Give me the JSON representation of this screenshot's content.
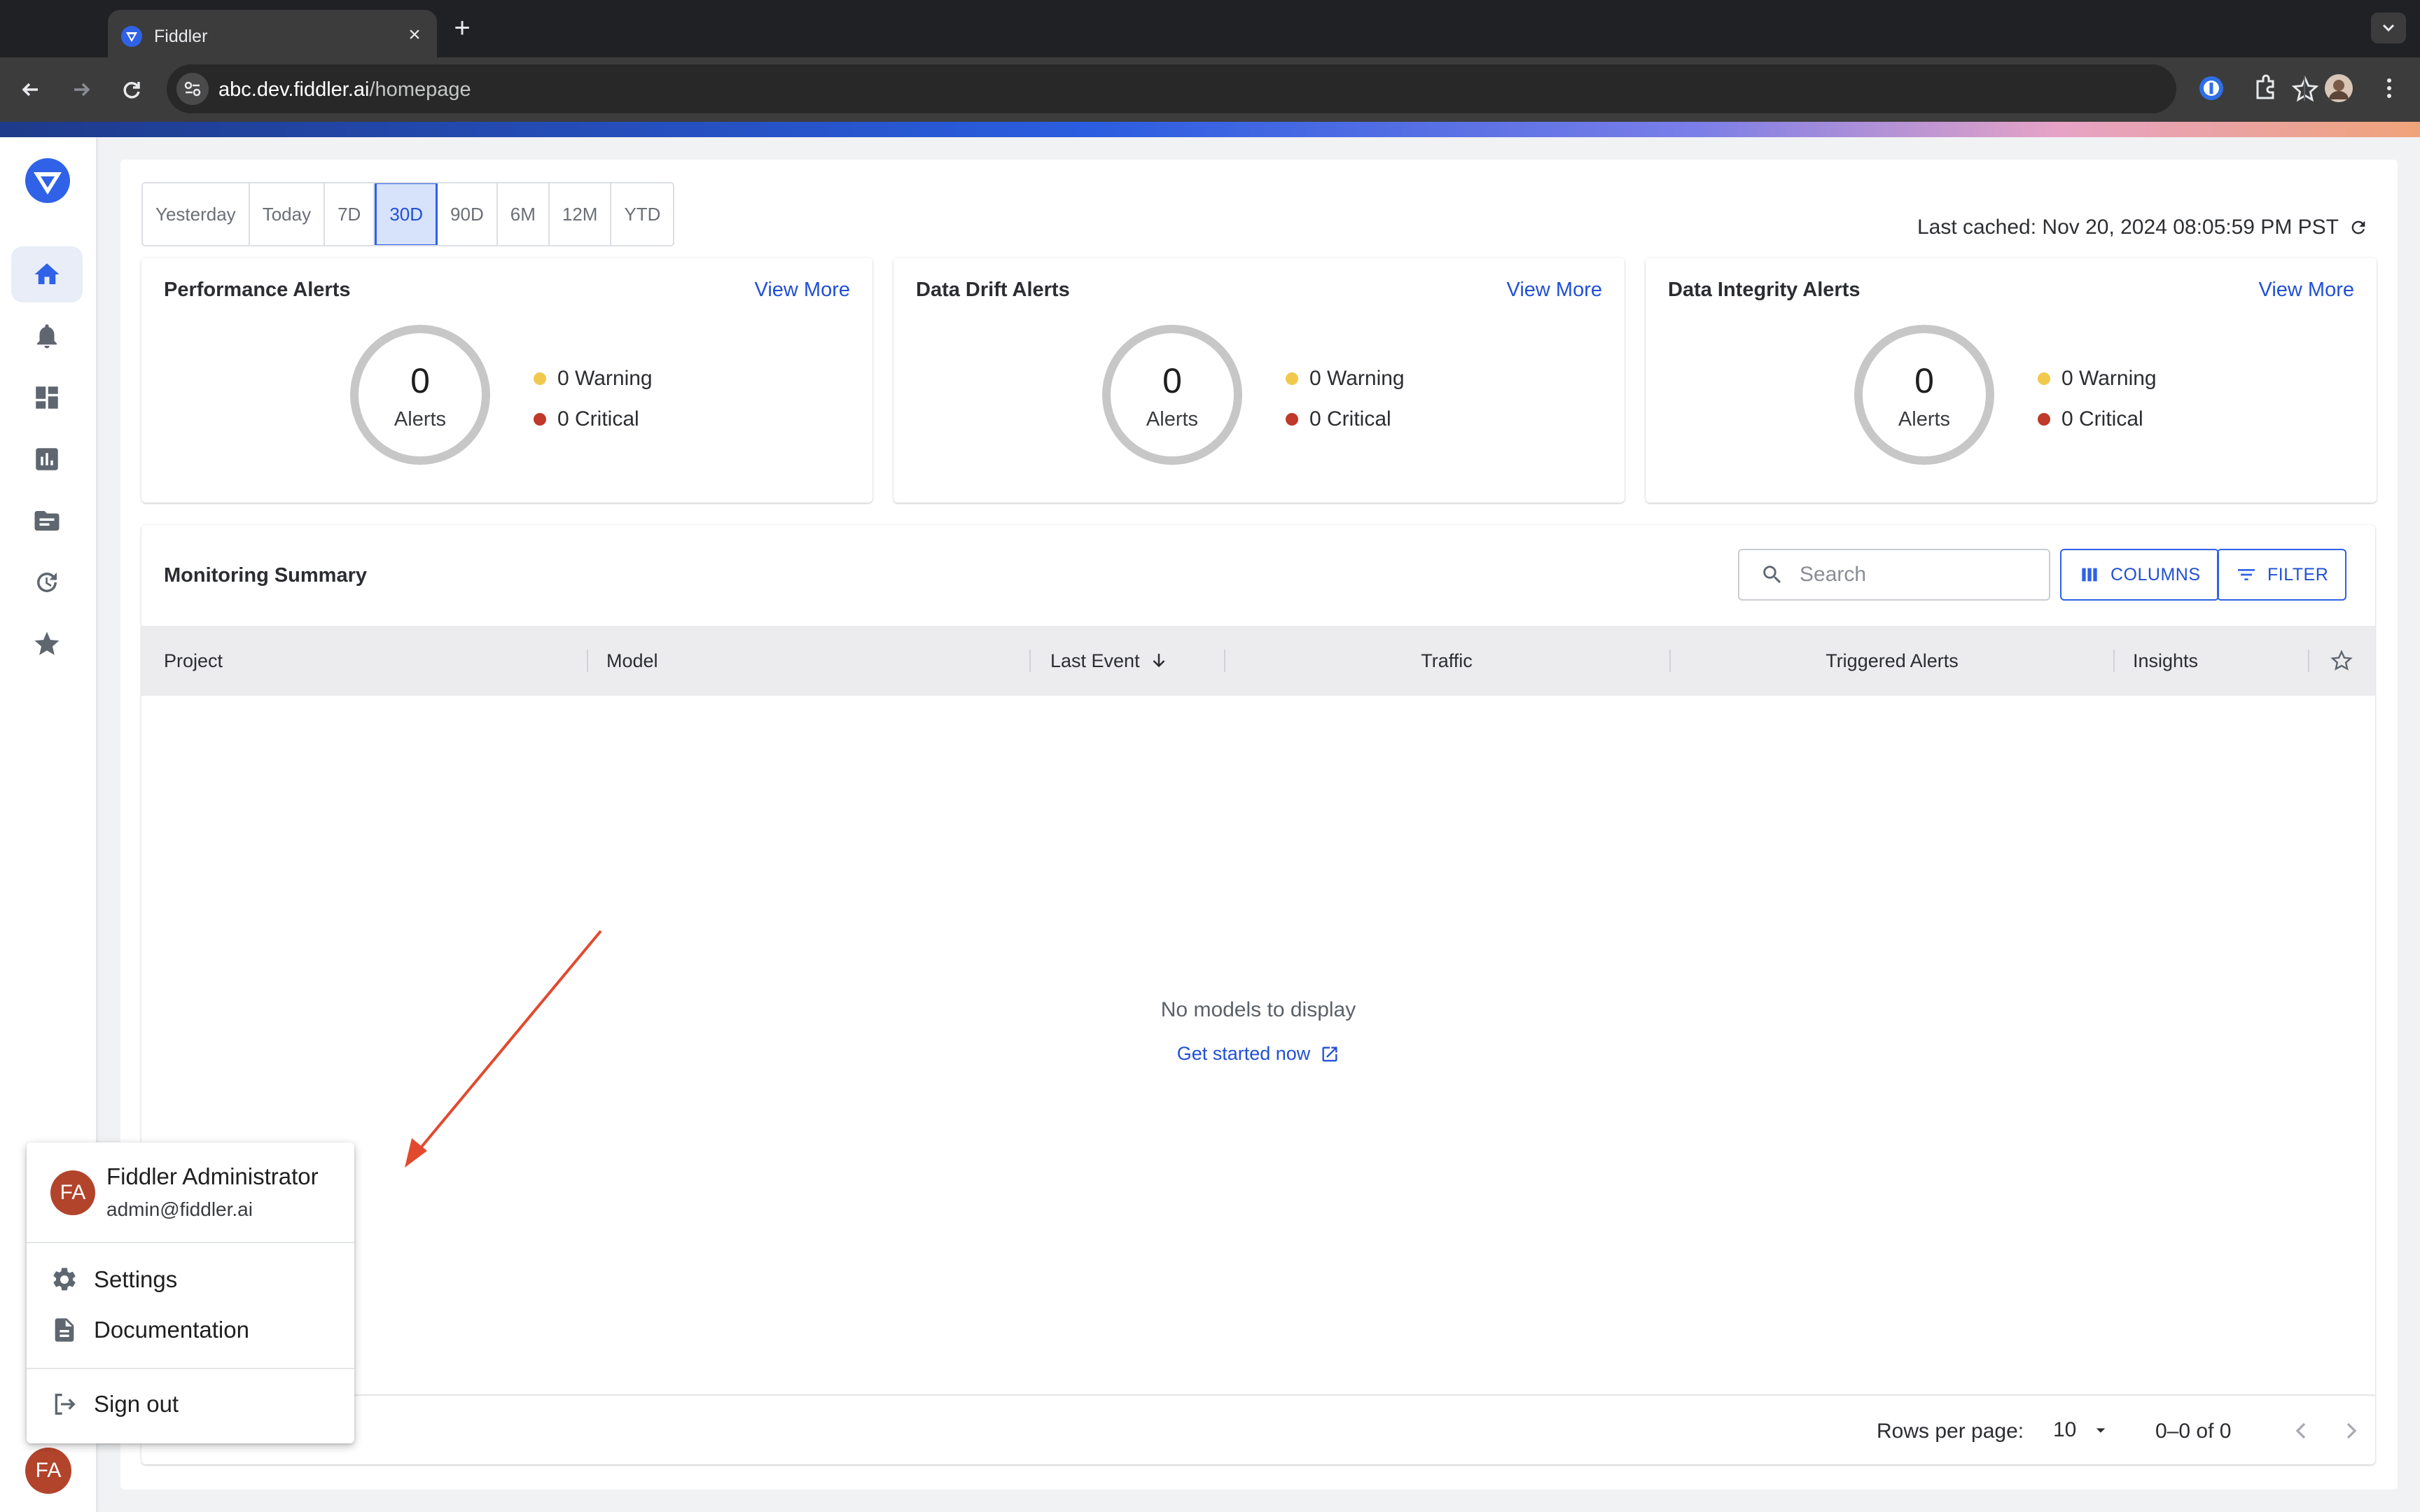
{
  "browser": {
    "tab_title": "Fiddler",
    "url_host": "abc.dev.fiddler.ai",
    "url_path": "/homepage"
  },
  "sidebar": {
    "items": [
      {
        "icon": "home-icon",
        "active": true
      },
      {
        "icon": "bell-icon",
        "active": false
      },
      {
        "icon": "dashboard-icon",
        "active": false
      },
      {
        "icon": "chart-icon",
        "active": false
      },
      {
        "icon": "folder-icon",
        "active": false
      },
      {
        "icon": "history-icon",
        "active": false
      },
      {
        "icon": "star-icon",
        "active": false
      }
    ],
    "avatar_initials": "FA"
  },
  "date_range": {
    "options": [
      "Yesterday",
      "Today",
      "7D",
      "30D",
      "90D",
      "6M",
      "12M",
      "YTD"
    ],
    "selected": "30D"
  },
  "last_cached": "Last cached: Nov 20, 2024 08:05:59 PM PST",
  "alert_cards": [
    {
      "title": "Performance Alerts",
      "view_more": "View More",
      "count": "0",
      "count_label": "Alerts",
      "warning": "0 Warning",
      "critical": "0 Critical"
    },
    {
      "title": "Data Drift Alerts",
      "view_more": "View More",
      "count": "0",
      "count_label": "Alerts",
      "warning": "0 Warning",
      "critical": "0 Critical"
    },
    {
      "title": "Data Integrity Alerts",
      "view_more": "View More",
      "count": "0",
      "count_label": "Alerts",
      "warning": "0 Warning",
      "critical": "0 Critical"
    }
  ],
  "colors": {
    "accent": "#2150d4",
    "warning": "#f2c94c",
    "critical": "#c0392b",
    "avatar": "#b2442c"
  },
  "summary": {
    "title": "Monitoring Summary",
    "search_placeholder": "Search",
    "columns_label": "COLUMNS",
    "filter_label": "FILTER",
    "headers": [
      "Project",
      "Model",
      "Last Event",
      "Traffic",
      "Triggered Alerts",
      "Insights"
    ],
    "empty_text": "No models to display",
    "get_started": "Get started now",
    "rows_per_page_label": "Rows per page:",
    "rows_per_page_value": "10",
    "pagination": "0–0 of 0"
  },
  "user_menu": {
    "initials": "FA",
    "name": "Fiddler Administrator",
    "email": "admin@fiddler.ai",
    "items": [
      "Settings",
      "Documentation",
      "Sign out"
    ]
  }
}
